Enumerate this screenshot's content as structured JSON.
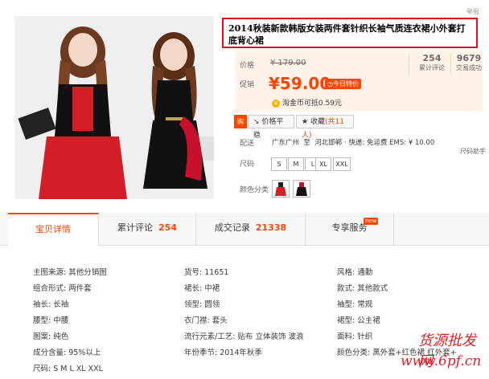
{
  "report_link": "举报",
  "title": "2014秋装新款韩版女装两件套针织长袖气质连衣裙小外套打底背心裙",
  "price": {
    "label": "价格",
    "original": "¥ 179.00"
  },
  "promo": {
    "label": "促销",
    "price": "¥59.00",
    "badge": "今日特价"
  },
  "stats": [
    {
      "value": "254",
      "label": "累计评论"
    },
    {
      "value": "9679",
      "label": "交易成功"
    }
  ],
  "coin": "淘金币可抵0.59元",
  "actions": {
    "price_compare": "价格平稳",
    "favorite": "收藏",
    "favorite_count": "(共11人)"
  },
  "shipping": {
    "label": "配送",
    "text": "广东广州  至  河北邯郸 · 快递: 免运费 EMS: ¥ 10.00"
  },
  "size_assistant": "尺码助手",
  "sizes": {
    "label": "尺码",
    "options": [
      "S",
      "M",
      "L",
      "XL",
      "XXL"
    ]
  },
  "colors": {
    "label": "颜色分类"
  },
  "tabs": [
    {
      "label": "宝贝详情",
      "count": ""
    },
    {
      "label": "累计评论",
      "count": "254"
    },
    {
      "label": "成交记录",
      "count": "21338"
    },
    {
      "label": "专享服务",
      "count": "",
      "badge": "new"
    }
  ],
  "attributes": {
    "col1": [
      "主图来源: 其他分销图",
      "组合形式: 两件套",
      "袖长: 长袖",
      "腰型: 中腰",
      "图案: 纯色",
      "成分含量: 95%以上",
      "尺码: S M L XL XXL"
    ],
    "col2": [
      "货号: 11651",
      "裙长: 中裙",
      "领型: 圆领",
      "衣门襟: 套头",
      "流行元素/工艺: 贴布 立体装饰 波浪",
      "年份季节: 2014年秋季"
    ],
    "col3": [
      "风格: 通勤",
      "款式: 其他款式",
      "袖型: 常规",
      "裙型: 公主裙",
      "面料: 针织",
      "颜色分类: 黑外套+红色裙 红外套+"
    ]
  },
  "watermark": {
    "line1": "货源批发网",
    "line2": "www.6pf.cn"
  },
  "colors_palette": {
    "accent": "#ff4400",
    "title_border": "#d9141f",
    "price_bg": "#fff2e8"
  }
}
